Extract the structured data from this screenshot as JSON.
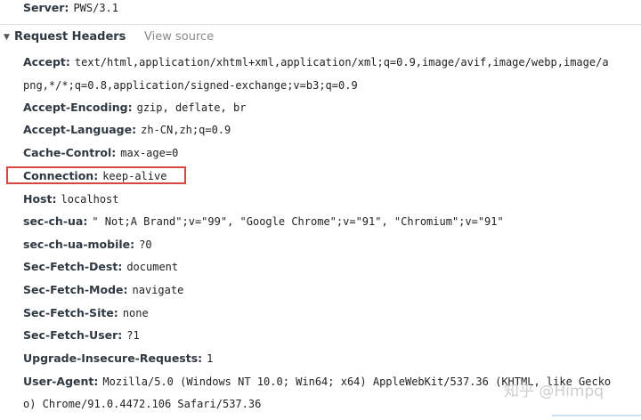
{
  "server_row": {
    "name": "Server:",
    "value": "PWS/3.1"
  },
  "section": {
    "title": "Request Headers",
    "view_source": "View source"
  },
  "headers": [
    {
      "name": "Accept:",
      "value": "text/html,application/xhtml+xml,application/xml;q=0.9,image/avif,image/webp,image/a",
      "continuation": "png,*/*;q=0.8,application/signed-exchange;v=b3;q=0.9"
    },
    {
      "name": "Accept-Encoding:",
      "value": "gzip, deflate, br"
    },
    {
      "name": "Accept-Language:",
      "value": "zh-CN,zh;q=0.9"
    },
    {
      "name": "Cache-Control:",
      "value": "max-age=0"
    },
    {
      "name": "Connection:",
      "value": "keep-alive"
    },
    {
      "name": "Host:",
      "value": "localhost"
    },
    {
      "name": "sec-ch-ua:",
      "value": "\" Not;A Brand\";v=\"99\", \"Google Chrome\";v=\"91\", \"Chromium\";v=\"91\""
    },
    {
      "name": "sec-ch-ua-mobile:",
      "value": "?0"
    },
    {
      "name": "Sec-Fetch-Dest:",
      "value": "document"
    },
    {
      "name": "Sec-Fetch-Mode:",
      "value": "navigate"
    },
    {
      "name": "Sec-Fetch-Site:",
      "value": "none"
    },
    {
      "name": "Sec-Fetch-User:",
      "value": "?1"
    },
    {
      "name": "Upgrade-Insecure-Requests:",
      "value": "1"
    },
    {
      "name": "User-Agent:",
      "value": "Mozilla/5.0 (Windows NT 10.0; Win64; x64) AppleWebKit/537.36 (KHTML, like Gecko",
      "continuation": "o) Chrome/91.0.4472.106 Safari/537.36"
    }
  ],
  "watermark": "知乎 @Himpq",
  "colors": {
    "highlight_border": "#d9453f",
    "header_name": "#303942",
    "view_source": "#8a8a8a"
  },
  "icons": {
    "section_toggle": "triangle-down-icon"
  }
}
